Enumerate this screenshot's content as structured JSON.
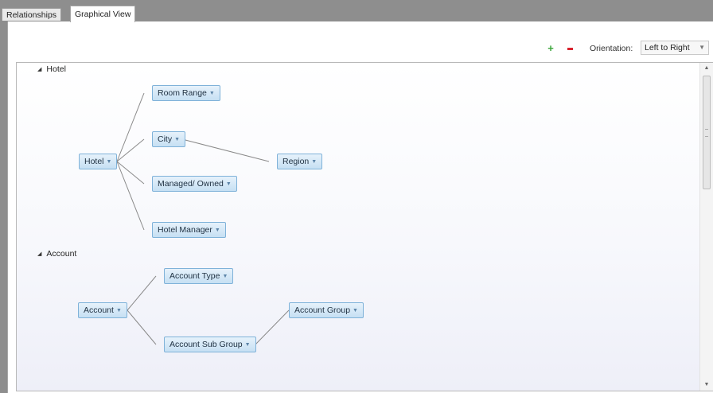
{
  "tabs": [
    {
      "label": "Relationships",
      "active": false
    },
    {
      "label": "Graphical View",
      "active": true
    }
  ],
  "toolbar": {
    "add_icon": "plus-icon",
    "remove_icon": "minus-icon",
    "orientation_label": "Orientation:",
    "orientation_value": "Left to Right"
  },
  "colors": {
    "add": "#3aa53a",
    "remove": "#d9232e",
    "node_border": "#7fb2d9",
    "node_fill": "#d4e8f7",
    "edge": "#8a8a8a"
  },
  "sections": [
    {
      "header": "Hotel",
      "nodes": {
        "hotel": "Hotel",
        "room_range": "Room Range",
        "city": "City",
        "managed_owned": "Managed/ Owned",
        "hotel_manager": "Hotel Manager",
        "region": "Region"
      }
    },
    {
      "header": "Account",
      "nodes": {
        "account": "Account",
        "account_type": "Account Type",
        "account_sub_group": "Account Sub Group",
        "account_group": "Account Group"
      }
    }
  ]
}
